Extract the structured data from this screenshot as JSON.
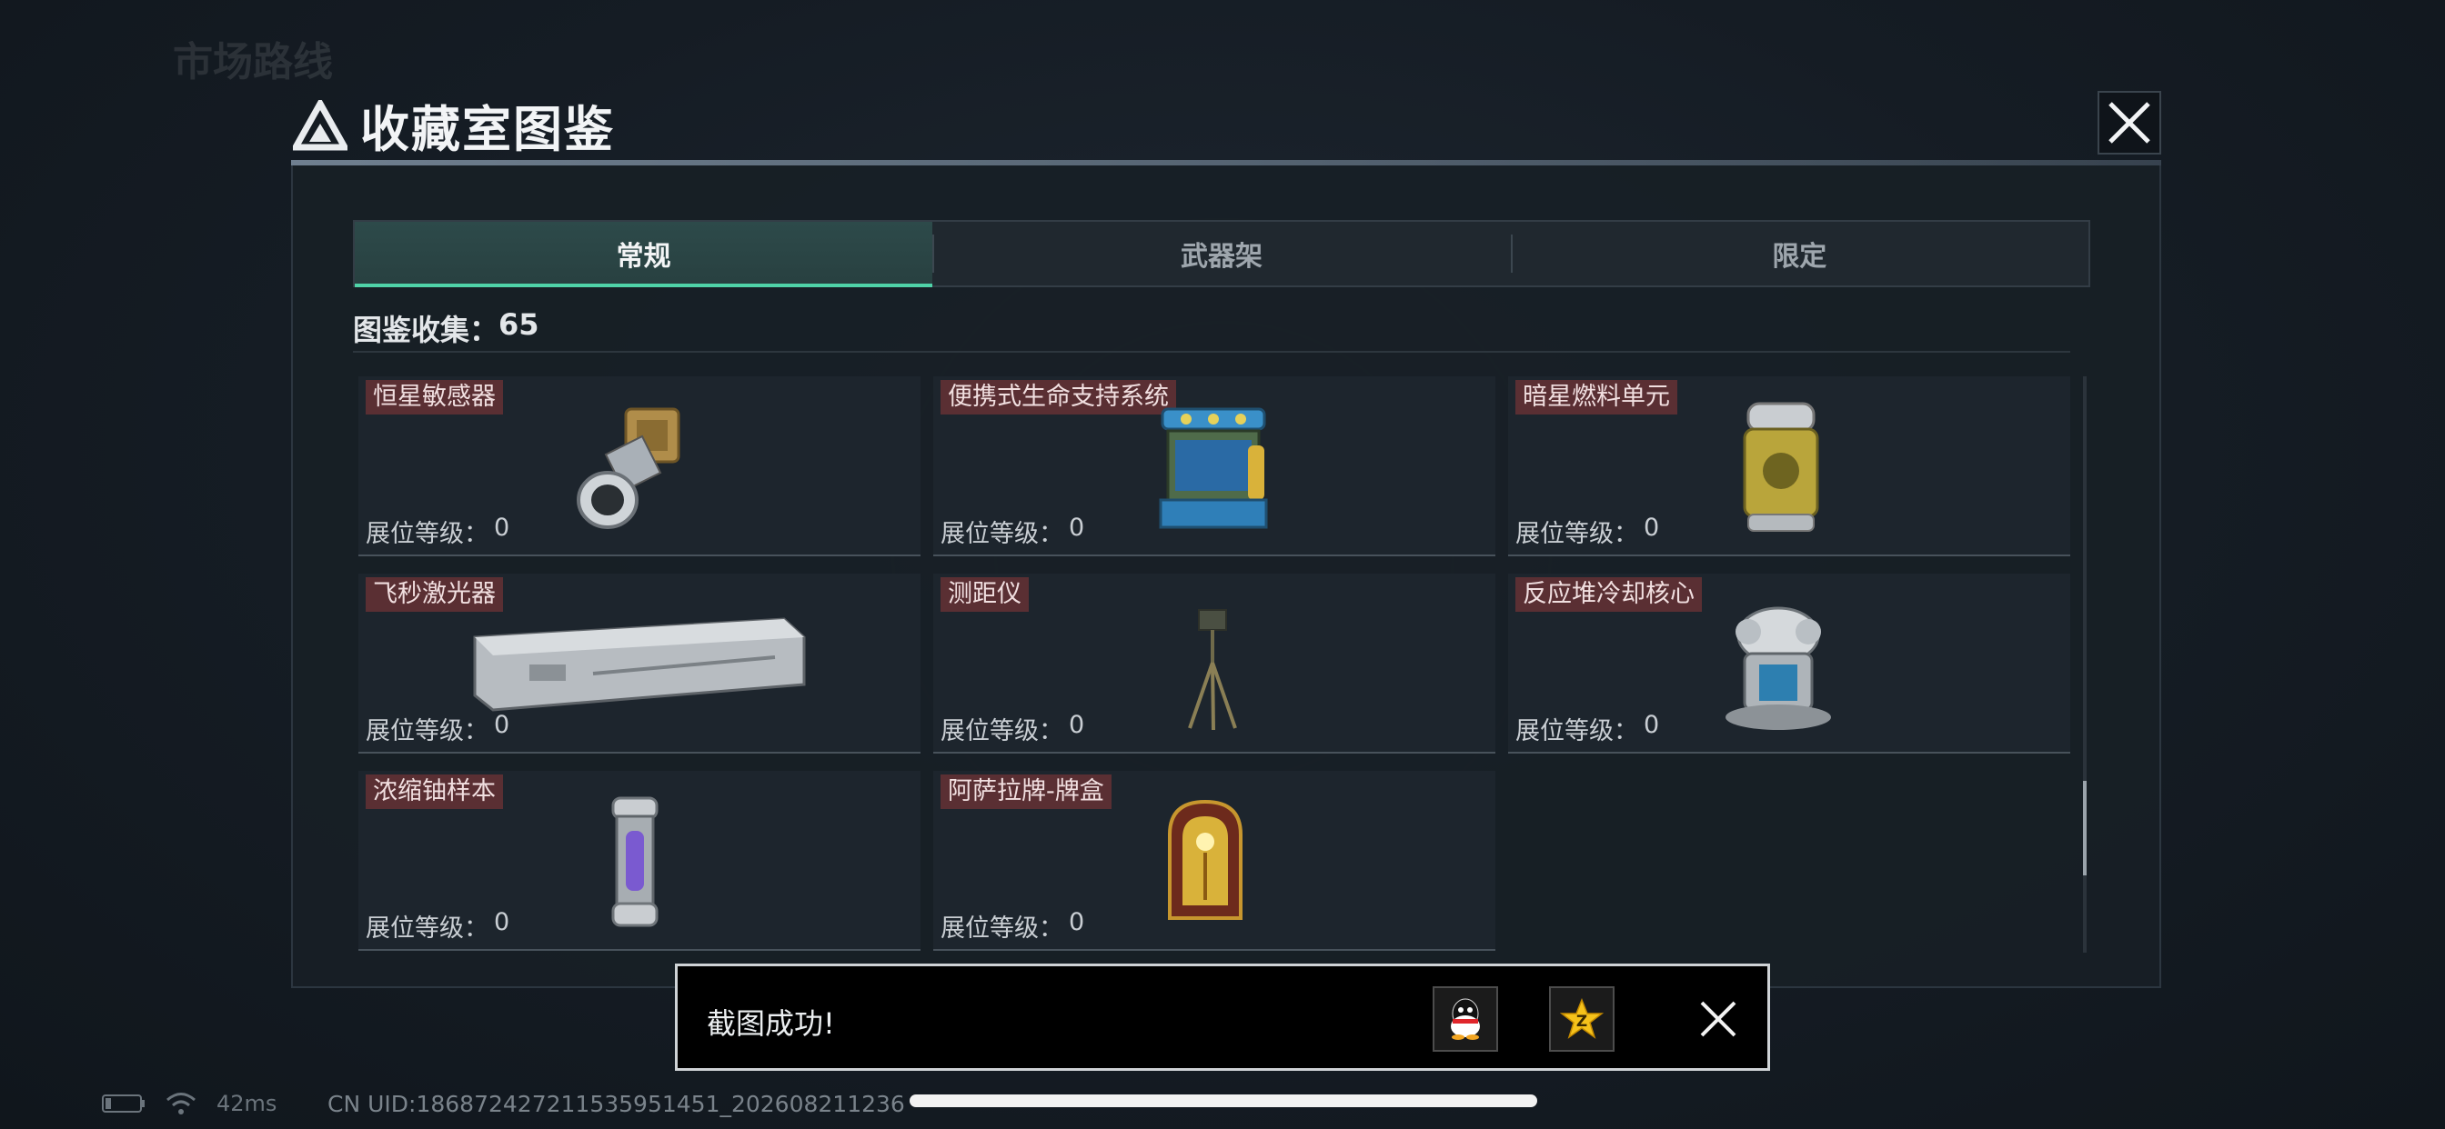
{
  "background": {
    "hint_top_left": "市场路线"
  },
  "modal": {
    "title": "收藏室图鉴",
    "tabs": [
      {
        "label": "常规",
        "active": true
      },
      {
        "label": "武器架",
        "active": false
      },
      {
        "label": "限定",
        "active": false
      }
    ],
    "collection_label": "图鉴收集：",
    "collection_count": "65",
    "level_label": "展位等级：",
    "items": [
      {
        "name": "恒星敏感器",
        "level": "0",
        "icon": "star-sensor-icon"
      },
      {
        "name": "便携式生命支持系统",
        "level": "0",
        "icon": "life-support-icon"
      },
      {
        "name": "暗星燃料单元",
        "level": "0",
        "icon": "fuel-cell-icon"
      },
      {
        "name": "飞秒激光器",
        "level": "0",
        "icon": "femtosecond-laser-icon"
      },
      {
        "name": "测距仪",
        "level": "0",
        "icon": "rangefinder-icon"
      },
      {
        "name": "反应堆冷却核心",
        "level": "0",
        "icon": "reactor-core-icon"
      },
      {
        "name": "浓缩铀样本",
        "level": "0",
        "icon": "uranium-sample-icon"
      },
      {
        "name": "阿萨拉牌-牌盒",
        "level": "0",
        "icon": "card-box-icon"
      }
    ],
    "scroll_position": 0.84
  },
  "toast": {
    "message": "截图成功!",
    "share_icons": [
      "qq-icon",
      "qzone-icon"
    ]
  },
  "status": {
    "ping": "42ms",
    "uid": "CN UID:1868724272115359514⁠51_202608211236"
  },
  "colors": {
    "accent": "#4fd3a8",
    "name_tag": "#5a2f33",
    "toast_border": "#cfd3d6"
  }
}
